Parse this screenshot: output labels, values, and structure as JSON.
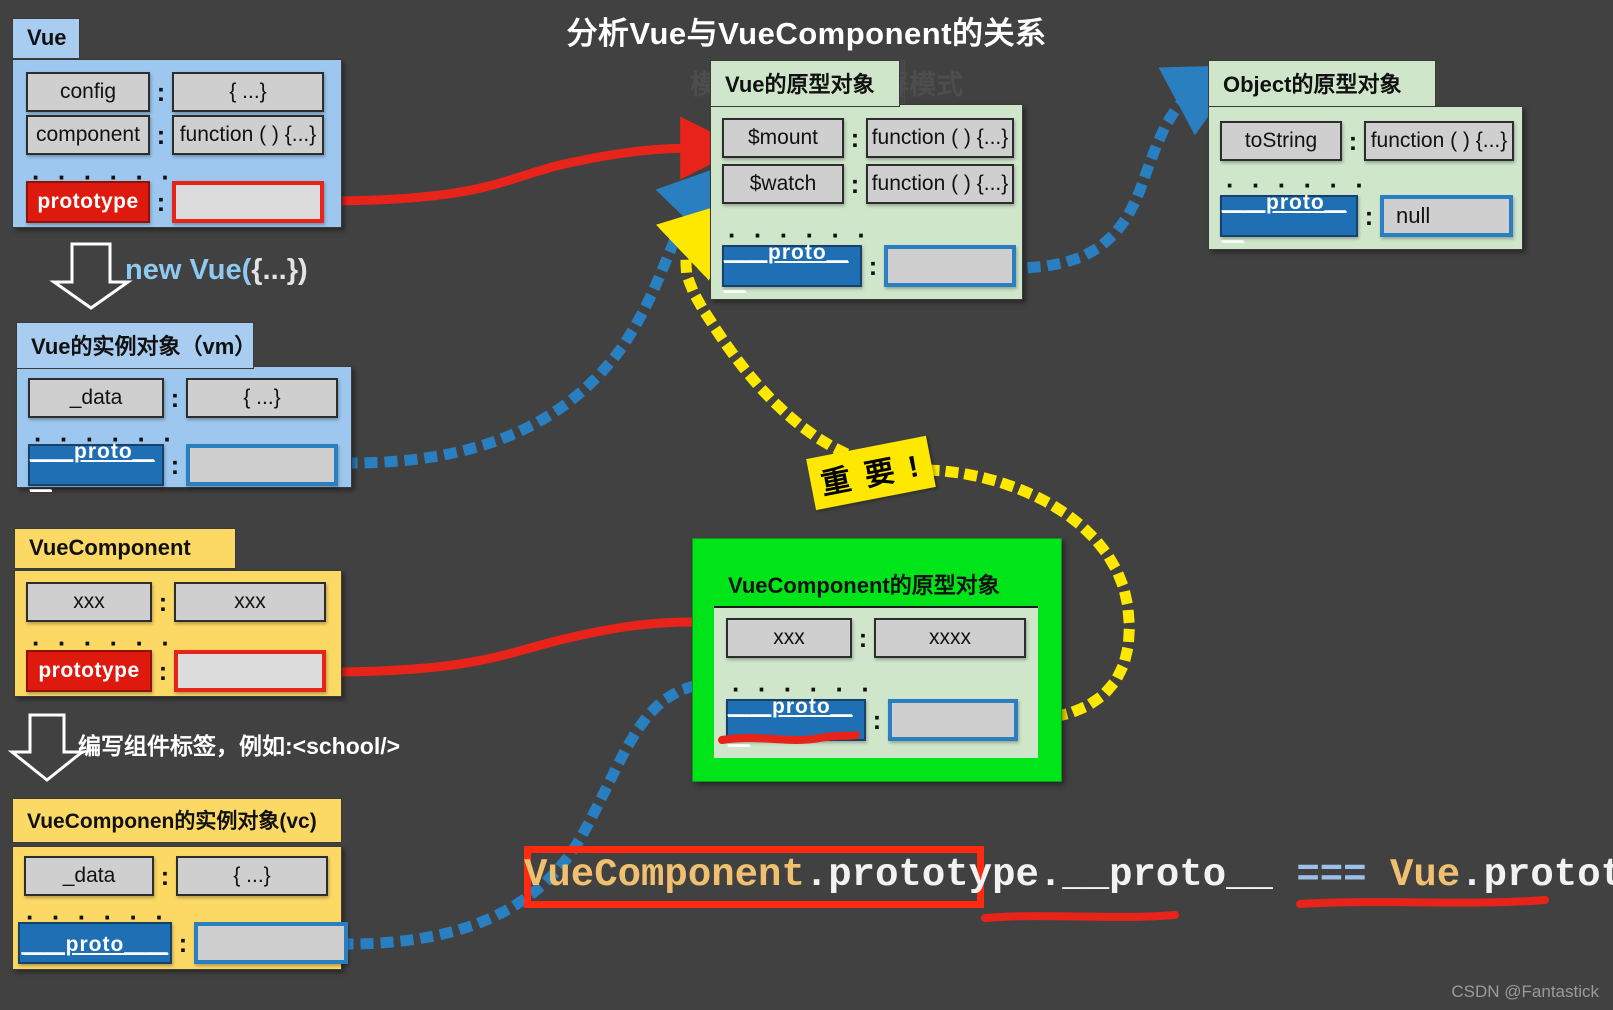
{
  "title": "分析Vue与VueComponent的关系",
  "watermark": {
    "left": "模式",
    "right": "全屏模式"
  },
  "credit": "CSDN @Fantastick",
  "labels": {
    "new_vue": "new Vue(",
    "new_vue_arg": "{...})",
    "write_tag": "编写组件标签，例如:<school/>",
    "important": "重 要 !",
    "dots": "· · · · · ·",
    "colon": ":"
  },
  "cards": {
    "vue": {
      "tab": "Vue",
      "rows": [
        {
          "key": "config",
          "value": "{ ...}"
        },
        {
          "key": "component",
          "value": "function ( ) {...}"
        }
      ],
      "proto_key": "prototype",
      "proto_value": ""
    },
    "vue_prototype": {
      "tab": "Vue的原型对象",
      "rows": [
        {
          "key": "$mount",
          "value": "function ( ) {...}"
        },
        {
          "key": "$watch",
          "value": "function ( ) {...}"
        }
      ],
      "proto_key": "＿＿proto＿＿",
      "proto_value": ""
    },
    "object_prototype": {
      "tab": "Object的原型对象",
      "rows": [
        {
          "key": "toString",
          "value": "function ( ) {...}"
        }
      ],
      "proto_key": "＿＿proto＿＿",
      "proto_value": "null"
    },
    "vm": {
      "tab": "Vue的实例对象（vm）",
      "rows": [
        {
          "key": "_data",
          "value": "{ ...}"
        }
      ],
      "proto_key": "＿＿proto＿＿",
      "proto_value": ""
    },
    "vuecomponent": {
      "tab": "VueComponent",
      "rows": [
        {
          "key": "xxx",
          "value": "xxx"
        }
      ],
      "proto_key": "prototype",
      "proto_value": ""
    },
    "vuecomponent_prototype": {
      "tab": "VueComponent的原型对象",
      "rows": [
        {
          "key": "xxx",
          "value": "xxxx"
        }
      ],
      "proto_key": "＿＿proto＿＿",
      "proto_value": ""
    },
    "vc": {
      "tab": "VueComponen的实例对象(vc)",
      "rows": [
        {
          "key": "_data",
          "value": "{ ...}"
        }
      ],
      "proto_key": "＿＿proto＿＿",
      "proto_value": ""
    }
  },
  "equation": {
    "part1": "VueComponent",
    "part2": ".prototype.__proto__",
    "operator": "===",
    "part3": "Vue",
    "part4": ".prototype"
  },
  "colors": {
    "background": "#414141",
    "blue_card": "#9dc7ef",
    "green_card": "#cfe6cb",
    "yellow_card": "#fcd965",
    "proto_key": "#1f6fb5",
    "prototype_key": "#de1a0f",
    "highlight_green": "#00e519",
    "highlight_red": "#ff2a10",
    "important_yellow": "#ffe800",
    "arrow_red": "#e8241a",
    "arrow_blue": "#2a7fc0",
    "arrow_yellow": "#ffe800"
  }
}
